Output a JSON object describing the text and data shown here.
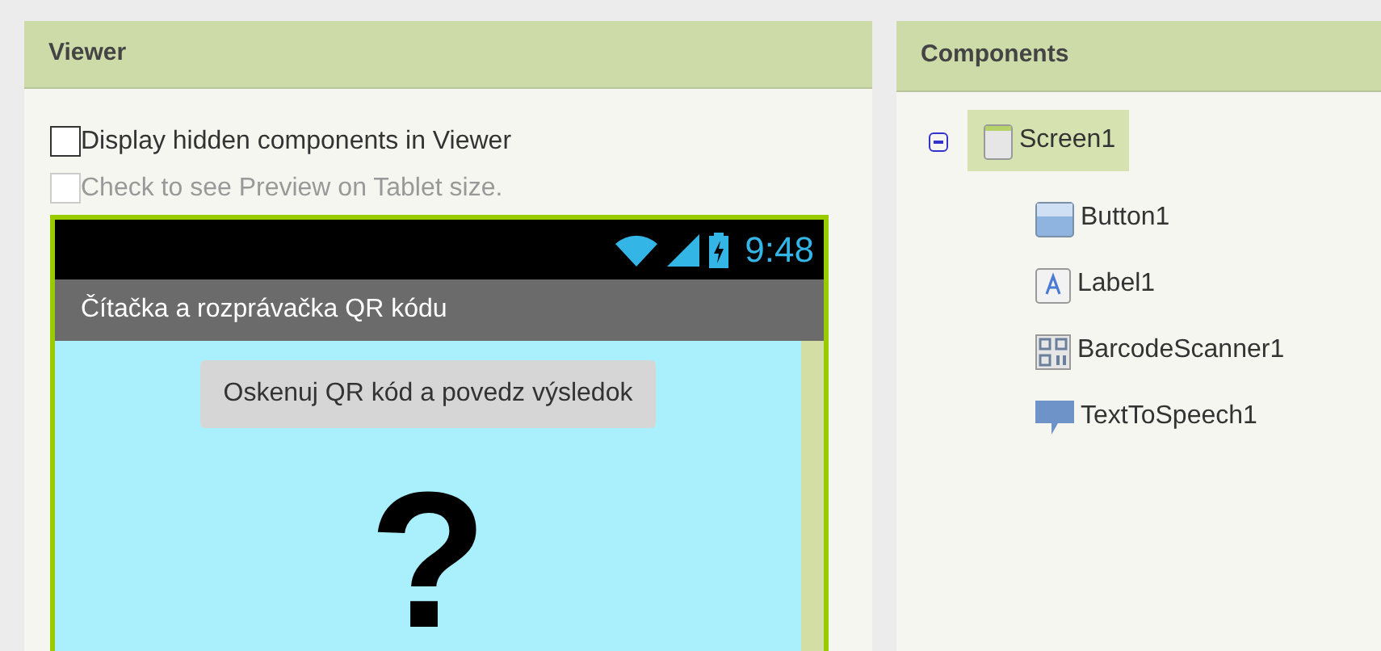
{
  "viewer": {
    "title": "Viewer",
    "options": [
      {
        "label": "Display hidden components in Viewer",
        "checked": false,
        "disabled": false
      },
      {
        "label": "Check to see Preview on Tablet size.",
        "checked": false,
        "disabled": true
      }
    ],
    "phone": {
      "time": "9:48",
      "app_title": "Čítačka a rozprávačka QR kódu",
      "button": "Oskenuj QR kód a povedz výsledok",
      "label": "?"
    }
  },
  "components": {
    "title": "Components",
    "tree": [
      {
        "name": "Screen1",
        "kind": "screen",
        "selected": true,
        "expanded": true,
        "children": [
          {
            "name": "Button1",
            "kind": "button",
            "selected": false
          },
          {
            "name": "Label1",
            "kind": "label",
            "selected": false
          },
          {
            "name": "BarcodeScanner1",
            "kind": "barcode",
            "selected": false
          },
          {
            "name": "TextToSpeech1",
            "kind": "speech",
            "selected": false
          }
        ]
      }
    ]
  }
}
